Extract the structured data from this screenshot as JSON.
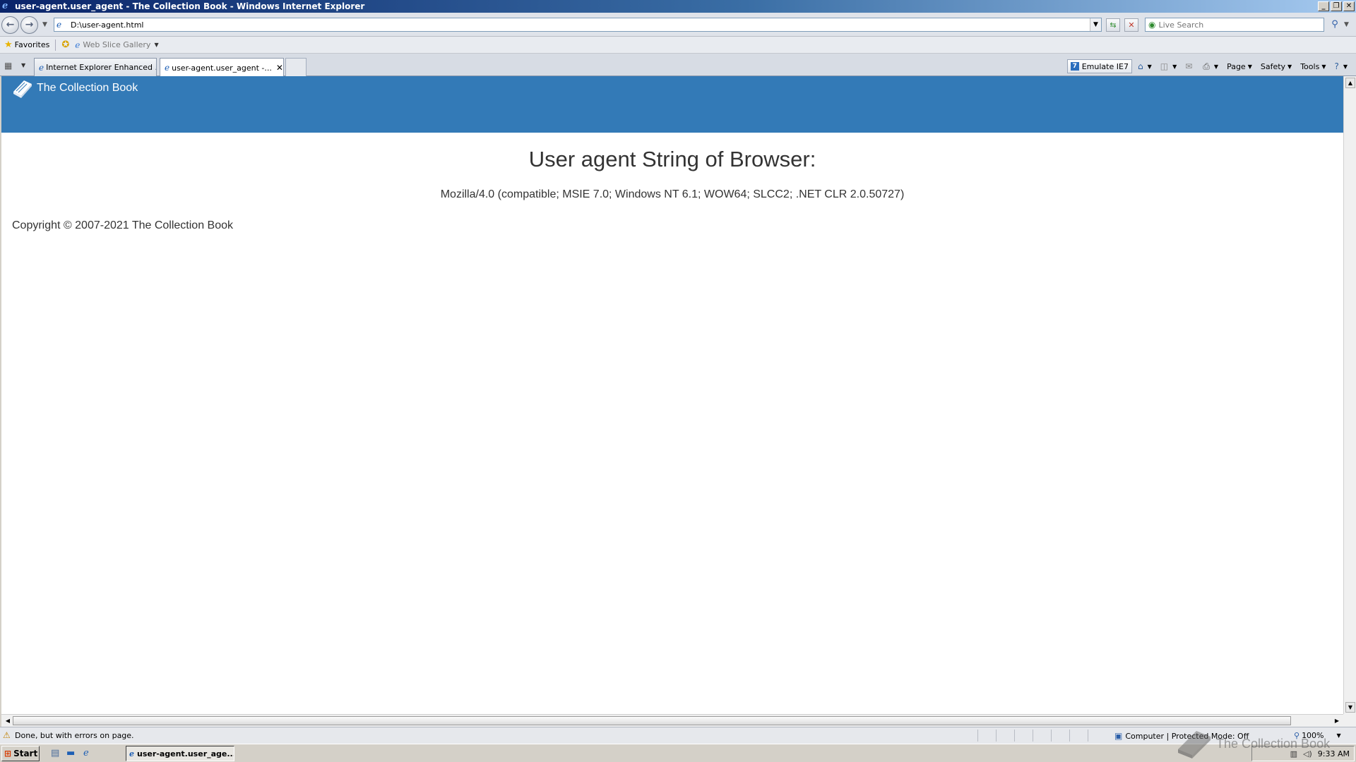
{
  "window": {
    "title": "user-agent.user_agent - The Collection Book - Windows Internet Explorer",
    "minimize": "_",
    "restore": "❐",
    "close": "✕"
  },
  "address_bar": {
    "url": "D:\\user-agent.html",
    "search_placeholder": "Live Search"
  },
  "favorites_bar": {
    "favorites_label": "Favorites",
    "web_slice_label": "Web Slice Gallery"
  },
  "tabs": [
    {
      "label": "Internet Explorer Enhanced ...",
      "active": false
    },
    {
      "label": "user-agent.user_agent -...",
      "active": true
    }
  ],
  "command_bar": {
    "emulate_label": "Emulate IE7",
    "page_label": "Page",
    "safety_label": "Safety",
    "tools_label": "Tools"
  },
  "page": {
    "brand_name": "The Collection Book",
    "heading": "User agent String of Browser:",
    "user_agent": "Mozilla/4.0 (compatible; MSIE 7.0; Windows NT 6.1; WOW64; SLCC2; .NET CLR 2.0.50727)",
    "copyright": "Copyright © 2007-2021 The Collection Book",
    "header_color": "#337ab7"
  },
  "status_bar": {
    "text": "Done, but with errors on page.",
    "zone": "Computer | Protected Mode: Off",
    "zoom": "100%"
  },
  "taskbar": {
    "start_label": "Start",
    "task_label": "user-agent.user_age...",
    "clock": "9:33 AM"
  },
  "watermark": {
    "text": "The Collection Book"
  },
  "icons": {
    "ie": "ie-icon",
    "back": "back-arrow-icon",
    "forward": "forward-arrow-icon",
    "refresh": "refresh-icon",
    "stop": "stop-icon",
    "search": "search-icon",
    "favorites": "star-icon",
    "home": "home-icon",
    "feeds": "rss-icon",
    "print": "print-icon",
    "help": "help-icon",
    "warning": "warning-icon",
    "book": "book-icon"
  }
}
